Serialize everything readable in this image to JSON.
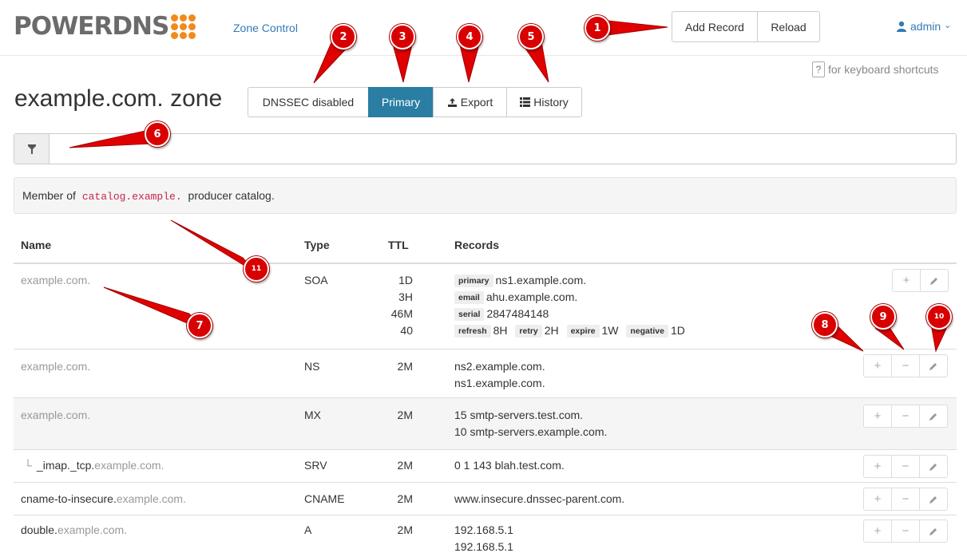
{
  "navbar": {
    "logo_text": "POWERDNS",
    "zone_control": "Zone Control",
    "add_record": "Add Record",
    "reload": "Reload",
    "user": "admin",
    "user_caret": "⌄"
  },
  "shortcut": {
    "key": "?",
    "text": "for keyboard shortcuts"
  },
  "zone": {
    "title": "example.com. zone",
    "dnssec": "DNSSEC disabled",
    "kind": "Primary",
    "export": "Export",
    "history": "History"
  },
  "filter": {
    "value": "",
    "icon": "filter-icon"
  },
  "catalog": {
    "prefix": "Member of",
    "name": "catalog.example.",
    "suffix": "producer catalog."
  },
  "table": {
    "headers": {
      "name": "Name",
      "type": "Type",
      "ttl": "TTL",
      "records": "Records"
    },
    "rows": [
      {
        "name_prefix": "",
        "name_suffix": "example.com.",
        "type": "SOA",
        "ttl": [
          "1D",
          "3H",
          "46M",
          "40"
        ],
        "soa": {
          "primary_label": "primary",
          "primary": "ns1.example.com.",
          "email_label": "email",
          "email": "ahu.example.com.",
          "serial_label": "serial",
          "serial": "2847484148",
          "refresh_label": "refresh",
          "refresh": "8H",
          "retry_label": "retry",
          "retry": "2H",
          "expire_label": "expire",
          "expire": "1W",
          "negative_label": "negative",
          "negative": "1D"
        }
      },
      {
        "name_prefix": "",
        "name_suffix": "example.com.",
        "type": "NS",
        "ttl": "2M",
        "records": [
          "ns2.example.com.",
          "ns1.example.com."
        ]
      },
      {
        "name_prefix": "",
        "name_suffix": "example.com.",
        "type": "MX",
        "ttl": "2M",
        "records": [
          "15 smtp-servers.test.com.",
          "10 smtp-servers.example.com."
        ]
      },
      {
        "tree": "└",
        "name_prefix": "_imap._tcp.",
        "name_suffix": "example.com.",
        "type": "SRV",
        "ttl": "2M",
        "records": [
          "0 1 143 blah.test.com."
        ]
      },
      {
        "name_prefix": "cname-to-insecure.",
        "name_suffix": "example.com.",
        "type": "CNAME",
        "ttl": "2M",
        "records": [
          "www.insecure.dnssec-parent.com."
        ]
      },
      {
        "name_prefix": "double.",
        "name_suffix": "example.com.",
        "type": "A",
        "ttl": "2M",
        "records": [
          "192.168.5.1",
          "192.168.5.1"
        ]
      }
    ]
  },
  "annotations": [
    "1",
    "2",
    "3",
    "4",
    "5",
    "6",
    "7",
    "8",
    "9",
    "10",
    "11"
  ],
  "colors": {
    "primary_active": "#2a7ea3",
    "link": "#337ab7",
    "annotation": "#d80000",
    "catalog_code": "#c7254e",
    "logo_dots": "#f28a1b"
  }
}
